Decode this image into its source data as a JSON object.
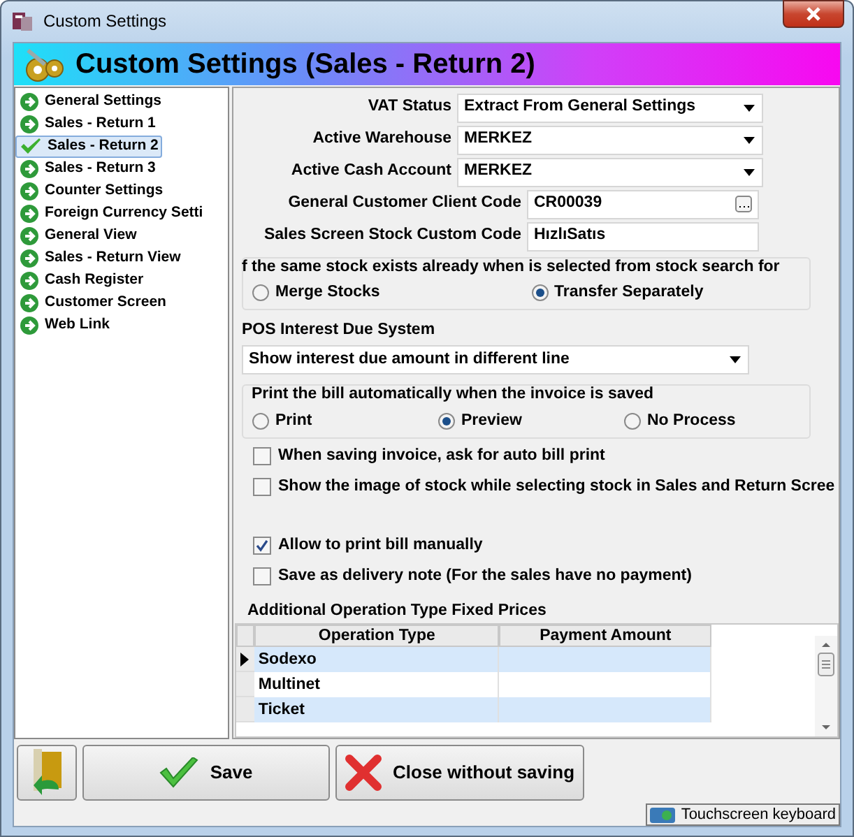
{
  "window": {
    "title": "Custom Settings"
  },
  "header": {
    "title": "Custom Settings (Sales - Return 2)"
  },
  "sidebar": {
    "items": [
      {
        "label": "General Settings",
        "selected": false
      },
      {
        "label": "Sales - Return 1",
        "selected": false
      },
      {
        "label": "Sales - Return 2",
        "selected": true
      },
      {
        "label": "Sales - Return 3",
        "selected": false
      },
      {
        "label": "Counter Settings",
        "selected": false
      },
      {
        "label": "Foreign Currency Setti",
        "selected": false
      },
      {
        "label": "General View",
        "selected": false
      },
      {
        "label": "Sales - Return View",
        "selected": false
      },
      {
        "label": "Cash Register",
        "selected": false
      },
      {
        "label": "Customer Screen",
        "selected": false
      },
      {
        "label": "Web Link",
        "selected": false
      }
    ]
  },
  "fields": [
    {
      "label": "VAT Status",
      "value": "Extract From General Settings",
      "kind": "dropdown"
    },
    {
      "label": "Active Warehouse",
      "value": "MERKEZ",
      "kind": "dropdown"
    },
    {
      "label": "Active Cash Account",
      "value": "MERKEZ",
      "kind": "dropdown"
    },
    {
      "label": "General Customer Client Code",
      "value": "CR00039",
      "kind": "lookup"
    },
    {
      "label": "Sales Screen Stock Custom Code",
      "value": "HızlıSatıs",
      "kind": "text"
    }
  ],
  "stock_group": {
    "title": "f the same stock exists already when is selected from stock search for",
    "options": [
      {
        "label": "Merge Stocks",
        "selected": false
      },
      {
        "label": "Transfer Separately",
        "selected": true
      }
    ]
  },
  "pos_interest": {
    "label": "POS Interest Due System",
    "value": "Show interest due amount in different line"
  },
  "print_group": {
    "title": "Print the bill automatically when the invoice is saved",
    "options": [
      {
        "label": "Print",
        "selected": false
      },
      {
        "label": "Preview",
        "selected": true
      },
      {
        "label": "No Process",
        "selected": false
      }
    ]
  },
  "checkboxes": [
    {
      "label": "When saving invoice, ask for auto bill print",
      "checked": false
    },
    {
      "label": "Show the image of stock while selecting stock in Sales and Return Scree",
      "checked": false
    },
    {
      "label": "Allow to print bill manually",
      "checked": true
    },
    {
      "label": "Save as delivery note (For the sales have no payment)",
      "checked": false
    }
  ],
  "table": {
    "title": "Additional Operation Type Fixed Prices",
    "columns": [
      "Operation Type",
      "Payment Amount"
    ],
    "rows": [
      {
        "cells": [
          "Sodexo",
          ""
        ],
        "current": true
      },
      {
        "cells": [
          "Multinet",
          ""
        ],
        "current": false
      },
      {
        "cells": [
          "Ticket",
          ""
        ],
        "current": false
      }
    ]
  },
  "buttons": [
    {
      "label": "Save",
      "kind": "save"
    },
    {
      "label": "Close without saving",
      "kind": "close"
    }
  ],
  "status_bar": {
    "keyboard": "Touchscreen keyboard"
  }
}
